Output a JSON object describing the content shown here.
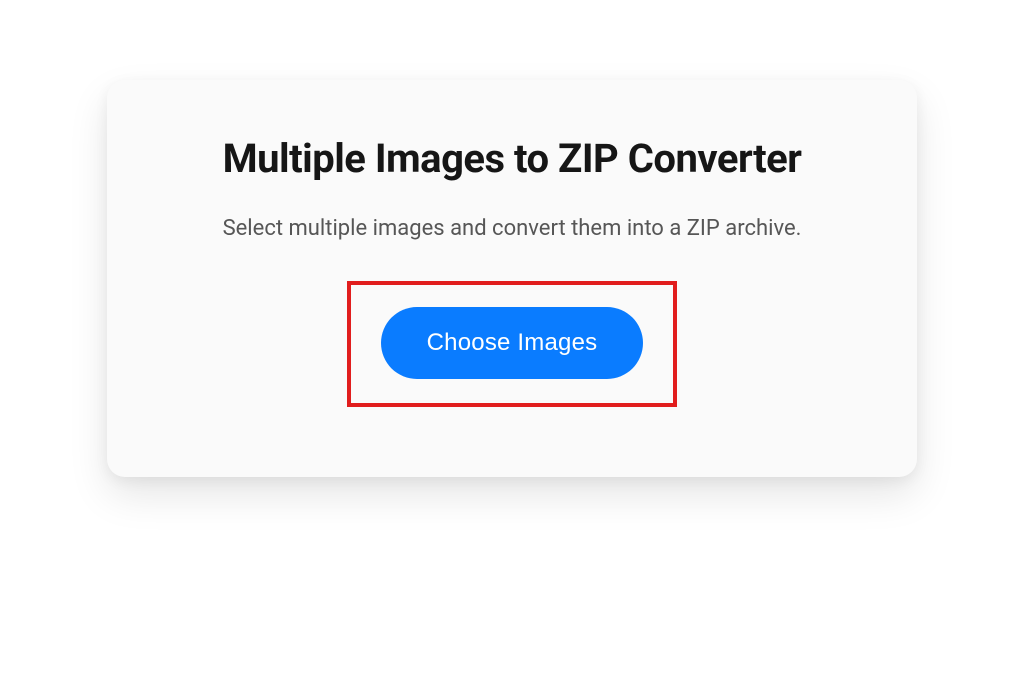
{
  "card": {
    "title": "Multiple Images to ZIP Converter",
    "subtitle": "Select multiple images and convert them into a ZIP archive.",
    "choose_button_label": "Choose Images"
  }
}
